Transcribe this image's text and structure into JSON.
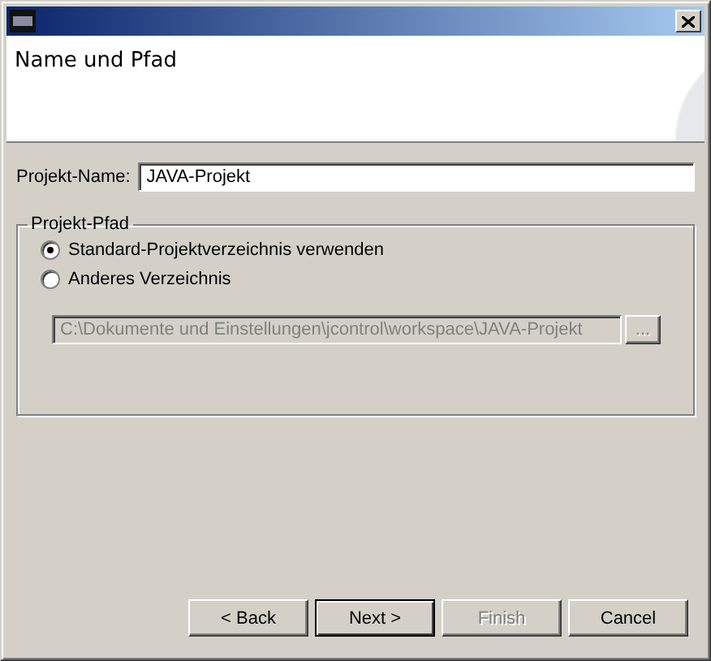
{
  "header": {
    "title": "Name und Pfad"
  },
  "project_name": {
    "label": "Projekt-Name:",
    "value": "JAVA-Projekt"
  },
  "project_path": {
    "legend": "Projekt-Pfad",
    "options": [
      {
        "label": "Standard-Projektverzeichnis verwenden",
        "selected": true
      },
      {
        "label": "Anderes Verzeichnis",
        "selected": false
      }
    ],
    "path": {
      "value": "C:\\Dokumente und Einstellungen\\jcontrol\\workspace\\JAVA-Projekt",
      "disabled": true
    },
    "browse": {
      "label": "...",
      "disabled": true
    }
  },
  "buttons": [
    {
      "label": "< Back",
      "disabled": false,
      "default": false
    },
    {
      "label": "Next >",
      "disabled": false,
      "default": true
    },
    {
      "label": "Finish",
      "disabled": true,
      "default": false
    },
    {
      "label": "Cancel",
      "disabled": false,
      "default": false
    }
  ]
}
